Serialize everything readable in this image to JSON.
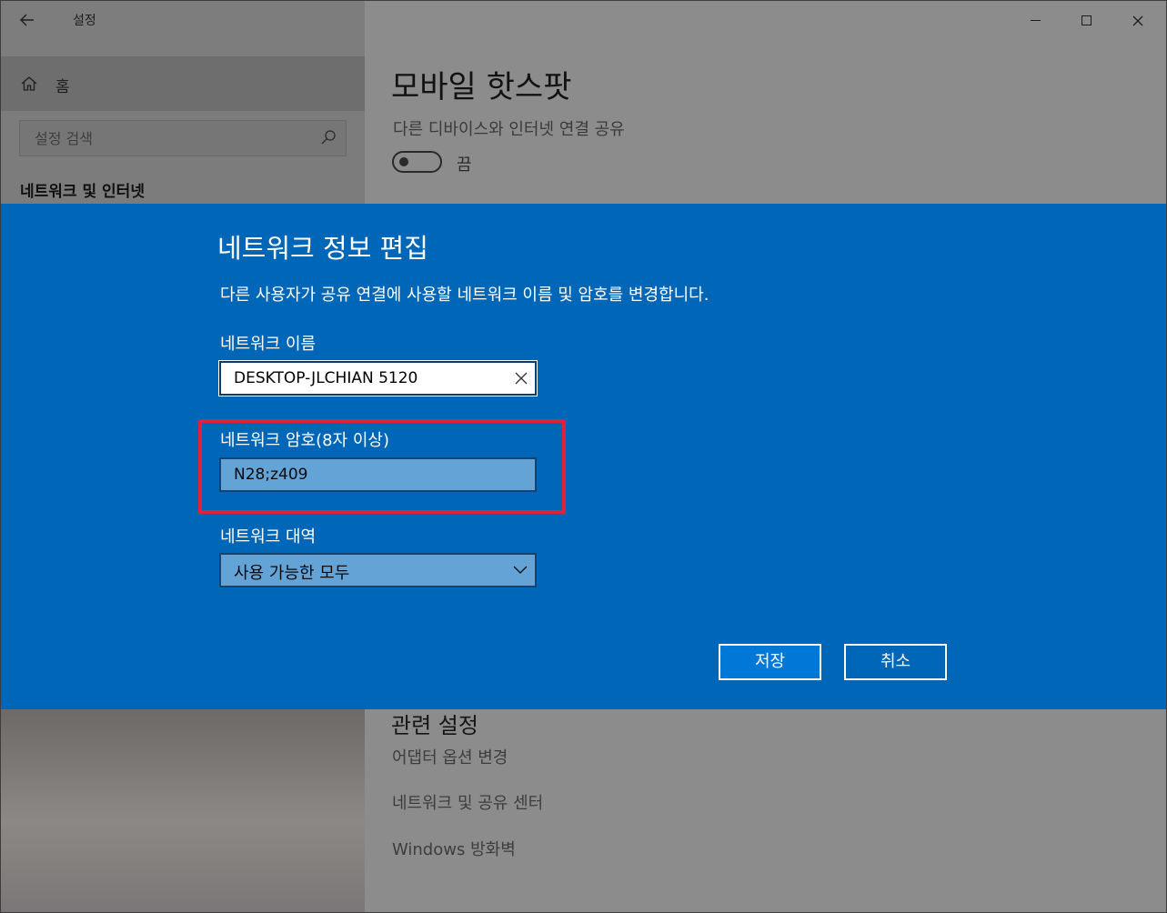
{
  "window": {
    "app_title": "설정",
    "back_icon": "arrow-left-icon",
    "min_icon": "minimize-icon",
    "max_icon": "maximize-icon",
    "close_icon": "close-icon"
  },
  "sidebar": {
    "home_label": "홈",
    "home_icon": "home-icon",
    "search_placeholder": "설정 검색",
    "search_icon": "search-icon",
    "section_title": "네트워크 및 인터넷"
  },
  "main": {
    "page_title": "모바일 핫스팟",
    "share_label": "다른 디바이스와 인터넷 연결 공유",
    "toggle_state_label": "끔",
    "toggle_on": false,
    "related_title": "관련 설정",
    "related_links": [
      "어댑터 옵션 변경",
      "네트워크 및 공유 센터",
      "Windows 방화벽"
    ]
  },
  "dialog": {
    "title": "네트워크 정보 편집",
    "description": "다른 사용자가 공유 연결에 사용할 네트워크 이름 및 암호를 변경합니다.",
    "name_label": "네트워크 이름",
    "name_value": "DESKTOP-JLCHIAN 5120",
    "password_label": "네트워크 암호(8자 이상)",
    "password_value": "N28;z409",
    "band_label": "네트워크 대역",
    "band_value": "사용 가능한 모두",
    "save_label": "저장",
    "cancel_label": "취소"
  },
  "colors": {
    "dialog_bg": "#0067b8",
    "highlight_border": "#e3203c",
    "input_bg_active": "#64a3d6"
  }
}
